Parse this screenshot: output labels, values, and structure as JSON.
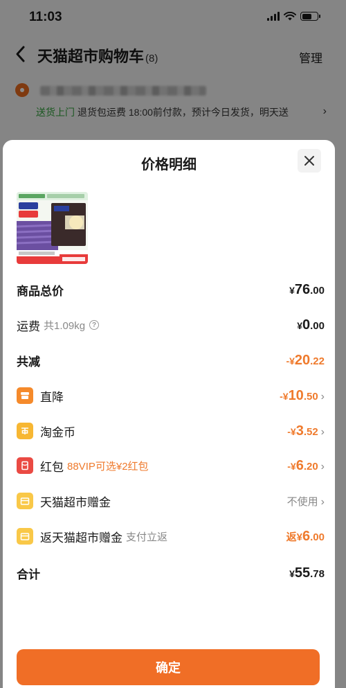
{
  "status_bar": {
    "time": "11:03"
  },
  "cart": {
    "title": "天猫超市购物车",
    "count": "(8)",
    "manage": "管理",
    "delivery_tag": "送货上门",
    "delivery_text": "退货包运费 18:00前付款，预计今日发货，明天送"
  },
  "sheet": {
    "title": "价格明细",
    "rows": {
      "total": {
        "label": "商品总价",
        "sym": "¥",
        "int": "76",
        "dec": ".00"
      },
      "shipping": {
        "label": "运费",
        "sub": "共1.09kg",
        "info": "?",
        "sym": "¥",
        "int": "0",
        "dec": ".00"
      },
      "discount": {
        "label": "共减",
        "sym": "-¥",
        "int": "20",
        "dec": ".22"
      },
      "direct": {
        "label": "直降",
        "sym": "-¥",
        "int": "10",
        "dec": ".50"
      },
      "coin": {
        "label": "淘金币",
        "sym": "-¥",
        "int": "3",
        "dec": ".52"
      },
      "redpack": {
        "label": "红包",
        "sub": "88VIP可选¥2红包",
        "sym": "-¥",
        "int": "6",
        "dec": ".20"
      },
      "gift": {
        "label": "天猫超市赠金",
        "value": "不使用"
      },
      "rebate": {
        "label": "返天猫超市赠金",
        "sub": "支付立返",
        "sym": "返¥",
        "int": "6",
        "dec": ".00"
      },
      "sum": {
        "label": "合计",
        "sym": "¥",
        "int": "55",
        "dec": ".78"
      }
    },
    "confirm": "确定"
  },
  "colors": {
    "accent": "#f06e26",
    "discount": "#ef7a2c",
    "green_tag": "#2f9e3a"
  }
}
